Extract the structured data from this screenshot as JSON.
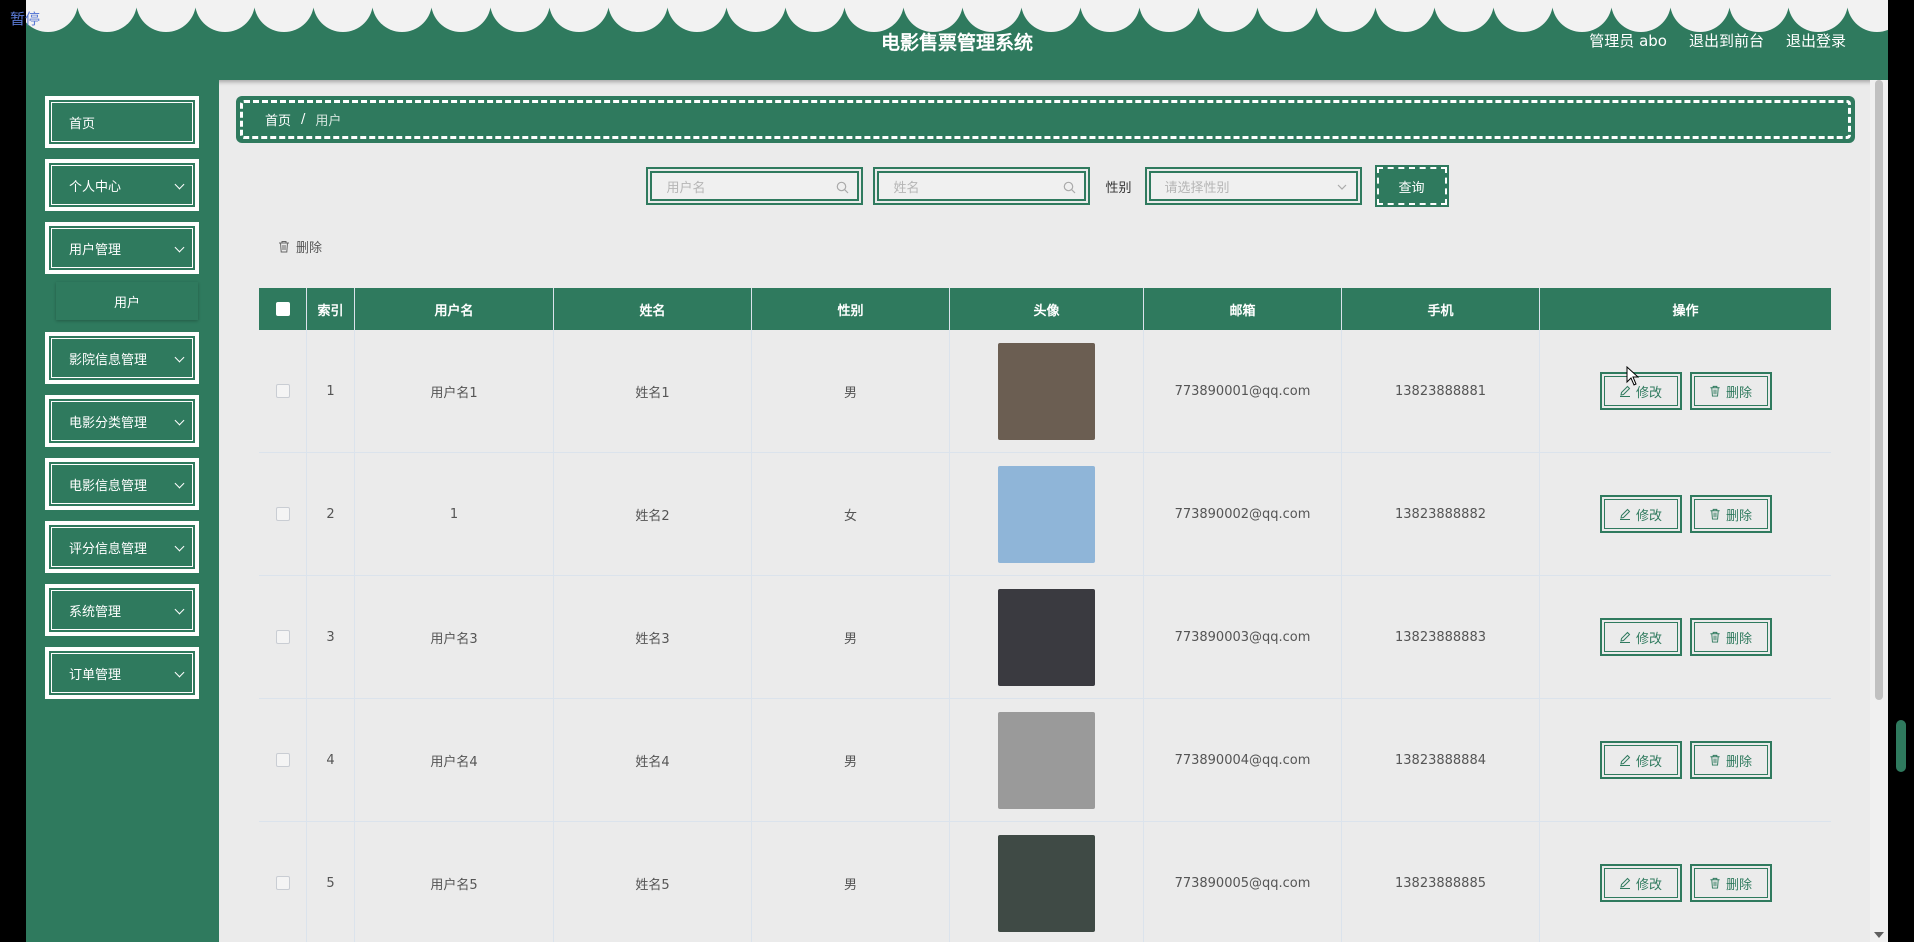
{
  "overlay": {
    "pause_label": "暂停"
  },
  "header": {
    "title": "电影售票管理系统",
    "admin": "管理员 abo",
    "to_front": "退出到前台",
    "logout": "退出登录"
  },
  "sidebar": {
    "items": [
      {
        "label": "首页"
      },
      {
        "label": "个人中心"
      },
      {
        "label": "用户管理"
      },
      {
        "label": "影院信息管理"
      },
      {
        "label": "电影分类管理"
      },
      {
        "label": "电影信息管理"
      },
      {
        "label": "评分信息管理"
      },
      {
        "label": "系统管理"
      },
      {
        "label": "订单管理"
      }
    ],
    "submenu": {
      "label": "用户"
    }
  },
  "breadcrumb": {
    "home": "首页",
    "sep": "/",
    "current": "用户"
  },
  "search": {
    "username_placeholder": "用户名",
    "name_placeholder": "姓名",
    "gender_label": "性别",
    "gender_placeholder": "请选择性别",
    "query_label": "查询"
  },
  "actions": {
    "delete_label": "删除"
  },
  "table": {
    "headers": [
      "索引",
      "用户名",
      "姓名",
      "性别",
      "头像",
      "邮箱",
      "手机",
      "操作"
    ],
    "edit_label": "修改",
    "delete_label": "删除",
    "rows": [
      {
        "index": "1",
        "username": "用户名1",
        "name": "姓名1",
        "gender": "男",
        "email": "773890001@qq.com",
        "phone": "13823888881",
        "avatar_color": "#6b5e52"
      },
      {
        "index": "2",
        "username": "1",
        "name": "姓名2",
        "gender": "女",
        "email": "773890002@qq.com",
        "phone": "13823888882",
        "avatar_color": "#8fb5d8"
      },
      {
        "index": "3",
        "username": "用户名3",
        "name": "姓名3",
        "gender": "男",
        "email": "773890003@qq.com",
        "phone": "13823888883",
        "avatar_color": "#3a3a40"
      },
      {
        "index": "4",
        "username": "用户名4",
        "name": "姓名4",
        "gender": "男",
        "email": "773890004@qq.com",
        "phone": "13823888884",
        "avatar_color": "#9a9a9a"
      },
      {
        "index": "5",
        "username": "用户名5",
        "name": "姓名5",
        "gender": "男",
        "email": "773890005@qq.com",
        "phone": "13823888885",
        "avatar_color": "#3f4a45"
      }
    ]
  },
  "colors": {
    "primary": "#2f7a5e",
    "background": "#ebebeb",
    "border": "#dbe3ec"
  }
}
